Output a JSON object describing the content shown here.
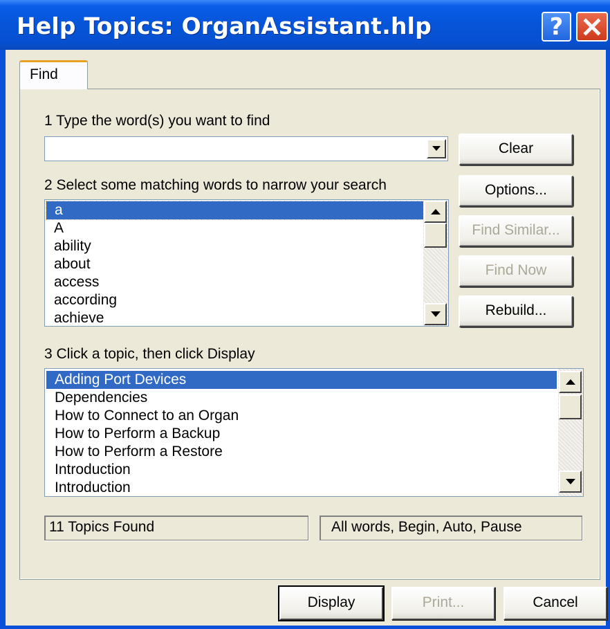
{
  "window": {
    "title": "Help Topics: OrganAssistant.hlp",
    "help_button": "?",
    "close_icon": "close-icon"
  },
  "tabs": [
    {
      "label": "Find",
      "active": true
    }
  ],
  "step1": {
    "label": "1 Type the word(s) you want to find",
    "input_value": ""
  },
  "step2": {
    "label": "2 Select some matching words to narrow your search",
    "words": [
      "a",
      "A",
      "ability",
      "about",
      "access",
      "according",
      "achieve"
    ],
    "selected_index": 0
  },
  "step3": {
    "label": "3 Click a topic, then click Display",
    "topics": [
      "Adding Port Devices",
      "Dependencies",
      "How to Connect to an Organ",
      "How to Perform a Backup",
      "How to Perform a Restore",
      "Introduction",
      "Introduction"
    ],
    "selected_index": 0
  },
  "side_buttons": {
    "clear": "Clear",
    "options": "Options...",
    "find_similar": "Find Similar...",
    "find_now": "Find Now",
    "rebuild": "Rebuild..."
  },
  "status": {
    "topics_found": "11 Topics Found",
    "search_options": "All words, Begin, Auto, Pause"
  },
  "bottom_buttons": {
    "display": "Display",
    "print": "Print...",
    "cancel": "Cancel"
  },
  "colors": {
    "titlebar": "#0654d8",
    "selection": "#316ac5",
    "face": "#ece9d8",
    "disabled_text": "#aca899"
  }
}
